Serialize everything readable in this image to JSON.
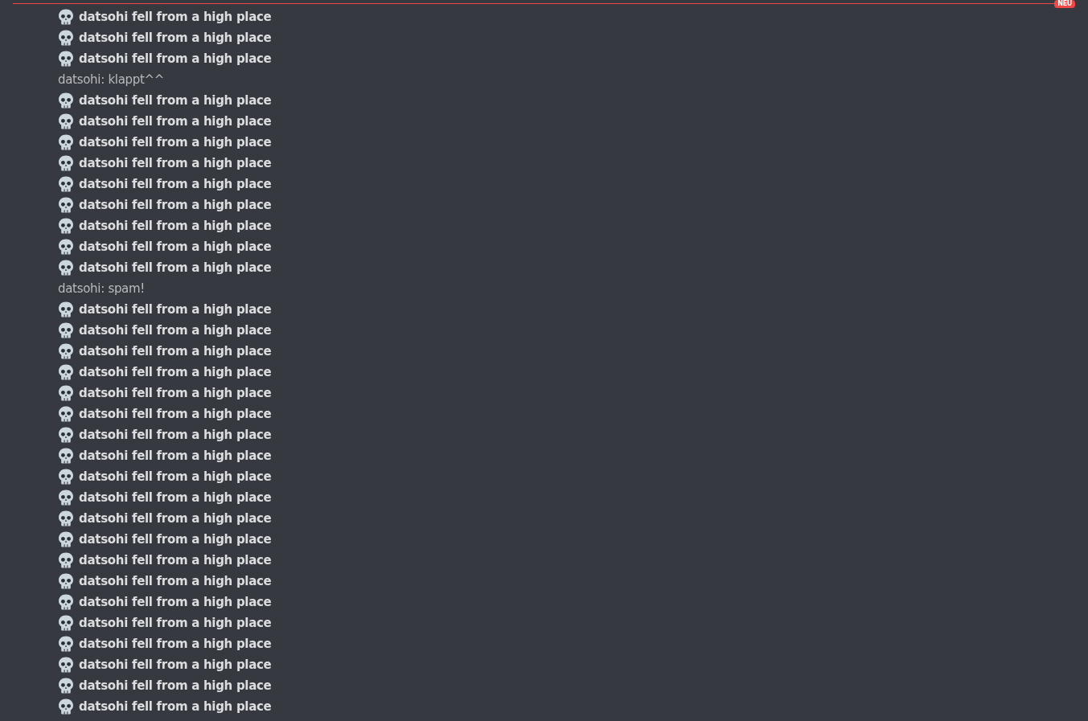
{
  "new_divider": {
    "label": "NEU"
  },
  "messages": [
    {
      "kind": "death",
      "text": "datsohi fell from a high place"
    },
    {
      "kind": "death",
      "text": "datsohi fell from a high place"
    },
    {
      "kind": "death",
      "text": "datsohi fell from a high place"
    },
    {
      "kind": "chat",
      "text": "datsohi: klappt^^"
    },
    {
      "kind": "death",
      "text": "datsohi fell from a high place"
    },
    {
      "kind": "death",
      "text": "datsohi fell from a high place"
    },
    {
      "kind": "death",
      "text": "datsohi fell from a high place"
    },
    {
      "kind": "death",
      "text": "datsohi fell from a high place"
    },
    {
      "kind": "death",
      "text": "datsohi fell from a high place"
    },
    {
      "kind": "death",
      "text": "datsohi fell from a high place"
    },
    {
      "kind": "death",
      "text": "datsohi fell from a high place"
    },
    {
      "kind": "death",
      "text": "datsohi fell from a high place"
    },
    {
      "kind": "death",
      "text": "datsohi fell from a high place"
    },
    {
      "kind": "chat",
      "text": "datsohi: spam!"
    },
    {
      "kind": "death",
      "text": "datsohi fell from a high place"
    },
    {
      "kind": "death",
      "text": "datsohi fell from a high place"
    },
    {
      "kind": "death",
      "text": "datsohi fell from a high place"
    },
    {
      "kind": "death",
      "text": "datsohi fell from a high place"
    },
    {
      "kind": "death",
      "text": "datsohi fell from a high place"
    },
    {
      "kind": "death",
      "text": "datsohi fell from a high place"
    },
    {
      "kind": "death",
      "text": "datsohi fell from a high place"
    },
    {
      "kind": "death",
      "text": "datsohi fell from a high place"
    },
    {
      "kind": "death",
      "text": "datsohi fell from a high place"
    },
    {
      "kind": "death",
      "text": "datsohi fell from a high place"
    },
    {
      "kind": "death",
      "text": "datsohi fell from a high place"
    },
    {
      "kind": "death",
      "text": "datsohi fell from a high place"
    },
    {
      "kind": "death",
      "text": "datsohi fell from a high place"
    },
    {
      "kind": "death",
      "text": "datsohi fell from a high place"
    },
    {
      "kind": "death",
      "text": "datsohi fell from a high place"
    },
    {
      "kind": "death",
      "text": "datsohi fell from a high place"
    },
    {
      "kind": "death",
      "text": "datsohi fell from a high place"
    },
    {
      "kind": "death",
      "text": "datsohi fell from a high place"
    },
    {
      "kind": "death",
      "text": "datsohi fell from a high place"
    },
    {
      "kind": "death",
      "text": "datsohi fell from a high place"
    }
  ]
}
